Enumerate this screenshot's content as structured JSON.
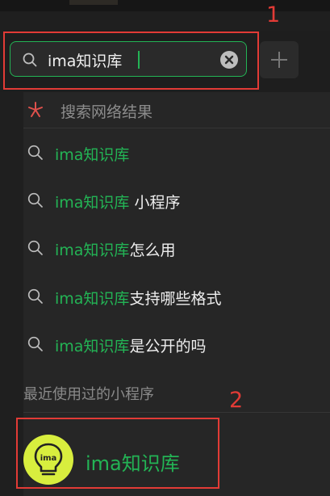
{
  "search": {
    "value": "ima知识库",
    "clear_icon": "close-circle-icon",
    "add_icon": "plus-icon"
  },
  "web_results": {
    "label": "搜索网络结果",
    "icon": "spark-icon"
  },
  "suggestions": [
    {
      "highlight": "ima知识库",
      "rest": ""
    },
    {
      "highlight": "ima知识库",
      "rest": " 小程序"
    },
    {
      "highlight": "ima知识库",
      "rest": "怎么用"
    },
    {
      "highlight": "ima知识库",
      "rest": "支持哪些格式"
    },
    {
      "highlight": "ima知识库",
      "rest": "是公开的吗"
    }
  ],
  "recent": {
    "header": "最近使用过的小程序",
    "apps": [
      {
        "name": "ima知识库",
        "icon": "ima-bulb-icon",
        "icon_text": "ima"
      }
    ]
  },
  "annotations": {
    "first": "1",
    "second": "2"
  },
  "colors": {
    "accent": "#23b455",
    "annotation": "#e23b36",
    "app_icon_bg": "#d8ee3e"
  }
}
